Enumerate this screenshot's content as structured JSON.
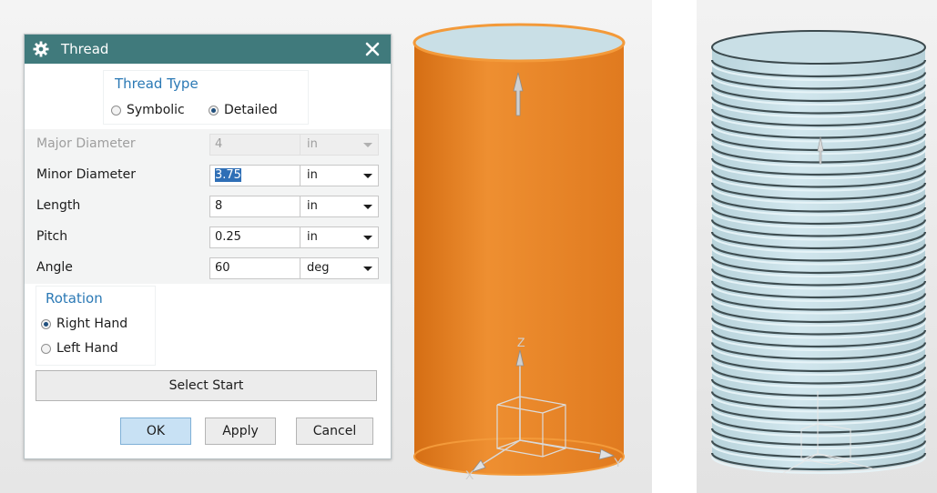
{
  "dialog": {
    "title": "Thread",
    "thread_type": {
      "heading": "Thread Type",
      "options": [
        "Symbolic",
        "Detailed"
      ],
      "selected": "Detailed"
    },
    "fields": [
      {
        "label": "Major Diameter",
        "value": "4",
        "unit": "in",
        "disabled": true
      },
      {
        "label": "Minor Diameter",
        "value": "3.75",
        "unit": "in",
        "disabled": false,
        "selected_text": true
      },
      {
        "label": "Length",
        "value": "8",
        "unit": "in",
        "disabled": false
      },
      {
        "label": "Pitch",
        "value": "0.25",
        "unit": "in",
        "disabled": false
      },
      {
        "label": "Angle",
        "value": "60",
        "unit": "deg",
        "disabled": false
      }
    ],
    "rotation": {
      "heading": "Rotation",
      "options": [
        "Right Hand",
        "Left Hand"
      ],
      "selected": "Right Hand"
    },
    "select_start_label": "Select Start",
    "buttons": {
      "ok": "OK",
      "apply": "Apply",
      "cancel": "Cancel"
    }
  },
  "viewport": {
    "axis_labels": {
      "z": "Z",
      "x": "X",
      "y": "Y"
    },
    "colors": {
      "cylinder_body": "#e8882d",
      "cylinder_top": "#c9dfe6",
      "threaded_body": "#c6dde4",
      "thread_dark": "#3f4e52"
    }
  },
  "icons": {
    "title_icon": "gear-icon",
    "close_icon": "close-icon"
  }
}
